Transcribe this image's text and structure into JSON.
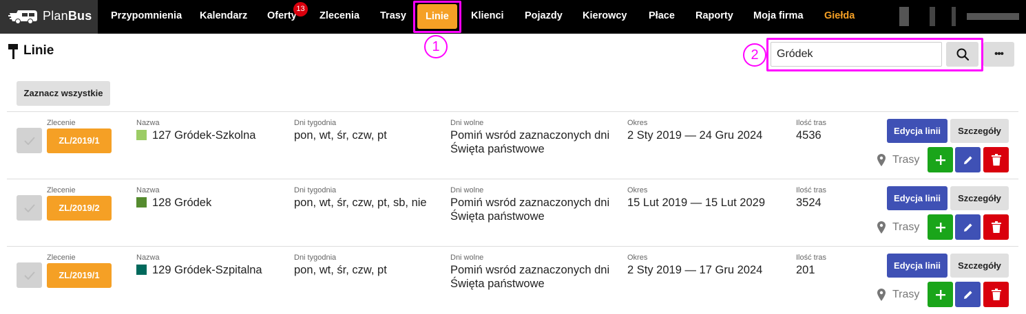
{
  "app": {
    "logo_text_light": "Plan",
    "logo_text_bold": "Bus"
  },
  "nav": {
    "items": [
      {
        "label": "Przypomnienia"
      },
      {
        "label": "Kalendarz"
      },
      {
        "label": "Oferty",
        "badge": "13"
      },
      {
        "label": "Zlecenia"
      },
      {
        "label": "Trasy"
      },
      {
        "label": "Linie",
        "active": true
      },
      {
        "label": "Klienci"
      },
      {
        "label": "Pojazdy"
      },
      {
        "label": "Kierowcy"
      },
      {
        "label": "Płace"
      },
      {
        "label": "Raporty"
      },
      {
        "label": "Moja firma"
      },
      {
        "label": "Giełda",
        "highlight_color": "#f5a025"
      }
    ]
  },
  "annotations": {
    "marker_1": "1",
    "marker_2": "2"
  },
  "page": {
    "title": "Linie",
    "title_icon": "signpost-icon"
  },
  "search": {
    "value": "Gródek",
    "button_icon": "search-icon",
    "more_label": "•••"
  },
  "toolbar": {
    "select_all_label": "Zaznacz wszystkie"
  },
  "columns": {
    "order": "Zlecenie",
    "name": "Nazwa",
    "weekdays": "Dni tygodnia",
    "days_off": "Dni wolne",
    "period": "Okres",
    "route_count": "Ilość tras"
  },
  "rows": [
    {
      "order": "ZL/2019/1",
      "name": "127 Gródek-Szkolna",
      "color": "#9ccc65",
      "weekdays": "pon, wt, śr, czw, pt",
      "days_off_1": "Pomiń wsród zaznaczonych dni",
      "days_off_2": "Święta państwowe",
      "period": "2 Sty 2019 — 24 Gru 2024",
      "route_count": "4536",
      "edit_label": "Edycja linii",
      "details_label": "Szczegóły",
      "routes_label": "Trasy"
    },
    {
      "order": "ZL/2019/2",
      "name": "128 Gródek",
      "color": "#558b2f",
      "weekdays": "pon, wt, śr, czw, pt, sb, nie",
      "days_off_1": "Pomiń wsród zaznaczonych dni",
      "days_off_2": "Święta państwowe",
      "period": "15 Lut 2019 — 15 Lut 2029",
      "route_count": "3524",
      "edit_label": "Edycja linii",
      "details_label": "Szczegóły",
      "routes_label": "Trasy"
    },
    {
      "order": "ZL/2019/1",
      "name": "129 Gródek-Szpitalna",
      "color": "#00695c",
      "weekdays": "pon, wt, śr, czw, pt",
      "days_off_1": "Pomiń wsród zaznaczonych dni",
      "days_off_2": "Święta państwowe",
      "period": "2 Sty 2019 — 17 Gru 2024",
      "route_count": "201",
      "edit_label": "Edycja linii",
      "details_label": "Szczegóły",
      "routes_label": "Trasy"
    }
  ],
  "colors": {
    "accent_orange": "#f5a025",
    "primary_blue": "#3f51b5",
    "success_green": "#1aa51a",
    "danger_red": "#d9000d",
    "annotation_magenta": "#ff00ff"
  }
}
